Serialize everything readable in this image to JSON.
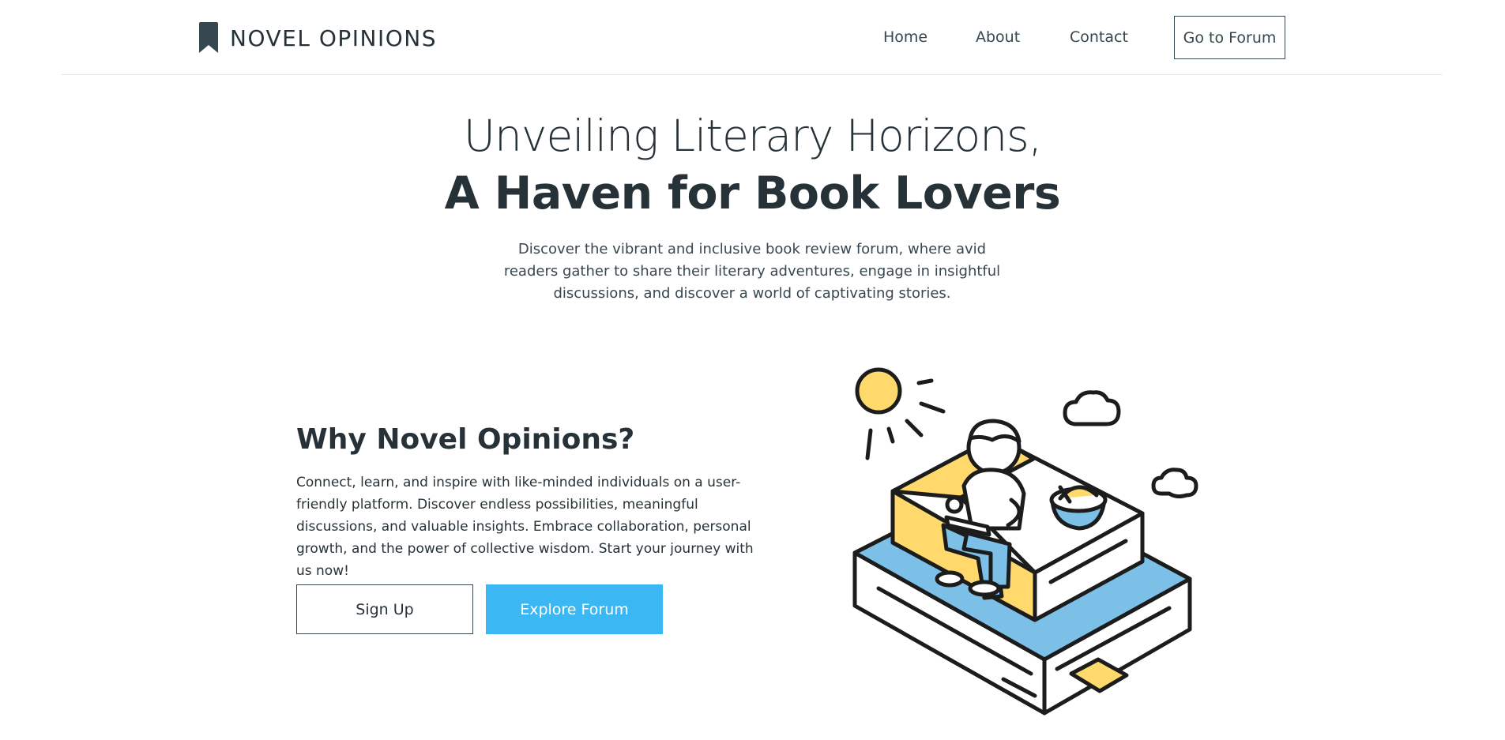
{
  "brand": {
    "name": "NOVEL OPINIONS",
    "icon": "bookmark-icon"
  },
  "nav": {
    "items": [
      {
        "label": "Home"
      },
      {
        "label": "About"
      },
      {
        "label": "Contact"
      }
    ],
    "cta_label": "Go to Forum"
  },
  "hero": {
    "title_line1": "Unveiling Literary Horizons,",
    "title_line2": "A Haven for Book Lovers",
    "description": "Discover the vibrant and inclusive book review forum, where avid readers gather to share their literary adventures, engage in insightful discussions, and discover a world of captivating stories."
  },
  "why": {
    "title": "Why Novel Opinions?",
    "text": "Connect, learn, and inspire with like-minded individuals on a user-friendly platform. Discover endless possibilities, meaningful discussions, and valuable insights. Embrace collaboration, personal growth, and the power of collective wisdom. Start your journey with us now!",
    "signup_label": "Sign Up",
    "explore_label": "Explore Forum"
  },
  "colors": {
    "text_dark": "#263238",
    "accent_blue": "#3bb8f3",
    "illustration_yellow": "#ffd96b",
    "illustration_blue": "#7cc0e8"
  }
}
